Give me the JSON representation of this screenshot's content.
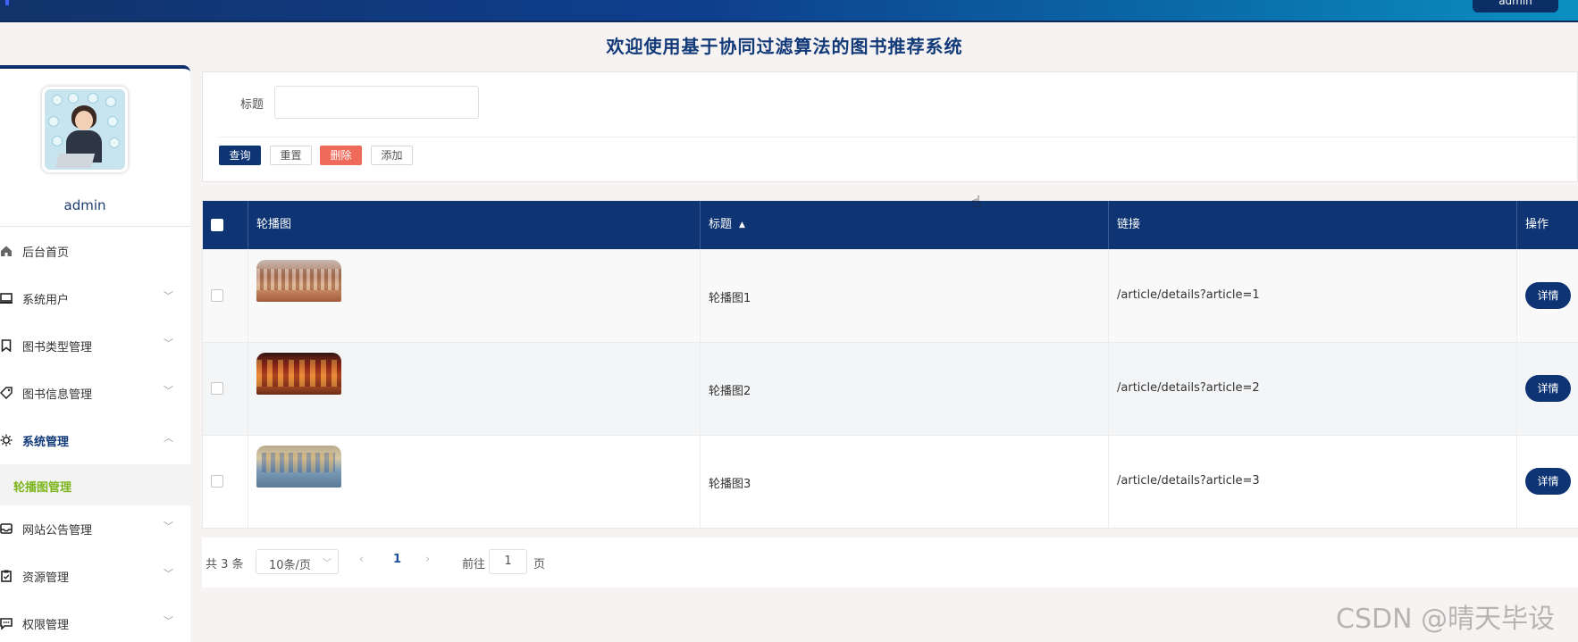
{
  "header": {
    "user_button": "admin",
    "site_title": "欢迎使用基于协同过滤算法的图书推荐系统"
  },
  "sidebar": {
    "username": "admin",
    "items": [
      {
        "label": "后台首页",
        "icon": "home-icon"
      },
      {
        "label": "系统用户",
        "icon": "monitor-icon"
      },
      {
        "label": "图书类型管理",
        "icon": "bookmark-icon"
      },
      {
        "label": "图书信息管理",
        "icon": "tag-icon"
      },
      {
        "label": "系统管理",
        "icon": "gear-icon"
      },
      {
        "label": "轮播图管理"
      },
      {
        "label": "网站公告管理",
        "icon": "inbox-icon"
      },
      {
        "label": "资源管理",
        "icon": "clipboard-icon"
      },
      {
        "label": "权限管理",
        "icon": "chat-icon"
      }
    ]
  },
  "filter": {
    "title_label": "标题",
    "title_value": "",
    "buttons": {
      "query": "查询",
      "reset": "重置",
      "delete": "删除",
      "add": "添加"
    }
  },
  "table": {
    "headers": {
      "image": "轮播图",
      "title": "标题",
      "link": "链接",
      "op": "操作"
    },
    "rows": [
      {
        "title": "轮播图1",
        "link": "/article/details?article=1",
        "action": "详情"
      },
      {
        "title": "轮播图2",
        "link": "/article/details?article=2",
        "action": "详情"
      },
      {
        "title": "轮播图3",
        "link": "/article/details?article=3",
        "action": "详情"
      }
    ]
  },
  "pagination": {
    "total": "共 3 条",
    "page_size": "10条/页",
    "current_page": "1",
    "goto_label": "前往",
    "goto_value": "1",
    "page_unit": "页"
  },
  "watermark": "CSDN @晴天毕设",
  "colors": {
    "primary": "#0e3473",
    "danger": "#ef6a5a",
    "active_submenu": "#7cb51c"
  }
}
